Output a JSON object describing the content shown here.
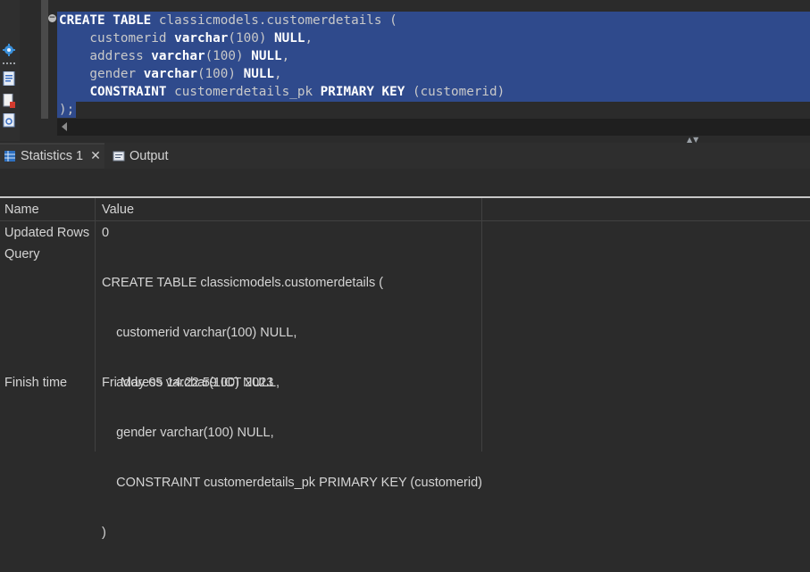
{
  "editor": {
    "toolbar_icons": [
      "gear-icon",
      "execute-script-icon",
      "export-icon",
      "plan-icon"
    ],
    "code_lines": [
      [
        {
          "t": "CREATE TABLE",
          "k": true
        },
        {
          "t": " classicmodels.customerdetails (",
          "k": false
        }
      ],
      [
        {
          "t": "    customerid ",
          "k": false
        },
        {
          "t": "varchar",
          "k": true
        },
        {
          "t": "(100) ",
          "k": false
        },
        {
          "t": "NULL",
          "k": true
        },
        {
          "t": ",",
          "k": false
        }
      ],
      [
        {
          "t": "    address ",
          "k": false
        },
        {
          "t": "varchar",
          "k": true
        },
        {
          "t": "(100) ",
          "k": false
        },
        {
          "t": "NULL",
          "k": true
        },
        {
          "t": ",",
          "k": false
        }
      ],
      [
        {
          "t": "    gender ",
          "k": false
        },
        {
          "t": "varchar",
          "k": true
        },
        {
          "t": "(100) ",
          "k": false
        },
        {
          "t": "NULL",
          "k": true
        },
        {
          "t": ",",
          "k": false
        }
      ],
      [
        {
          "t": "    ",
          "k": false
        },
        {
          "t": "CONSTRAINT",
          "k": true
        },
        {
          "t": " customerdetails_pk ",
          "k": false
        },
        {
          "t": "PRIMARY KEY",
          "k": true
        },
        {
          "t": " (customerid)",
          "k": false
        }
      ],
      [
        {
          "t": ");",
          "k": false
        }
      ]
    ]
  },
  "tabs": {
    "statistics_label": "Statistics 1",
    "output_label": "Output"
  },
  "stats": {
    "headers": {
      "name": "Name",
      "value": "Value"
    },
    "rows": [
      {
        "name": "Updated Rows",
        "value_lines": [
          "0"
        ]
      },
      {
        "name": "Query",
        "value_lines": [
          "CREATE TABLE classicmodels.customerdetails (",
          "    customerid varchar(100) NULL,",
          "    address varchar(100) NULL,",
          "    gender varchar(100) NULL,",
          "    CONSTRAINT customerdetails_pk PRIMARY KEY (customerid)",
          ")"
        ]
      },
      {
        "name": "Finish time",
        "value_lines": [
          "Fri May 05 14:22:59 ICT 2023"
        ]
      }
    ]
  },
  "colors": {
    "selection": "#2f4a8c",
    "background": "#2b2b2b",
    "text": "#d4d4d4"
  }
}
